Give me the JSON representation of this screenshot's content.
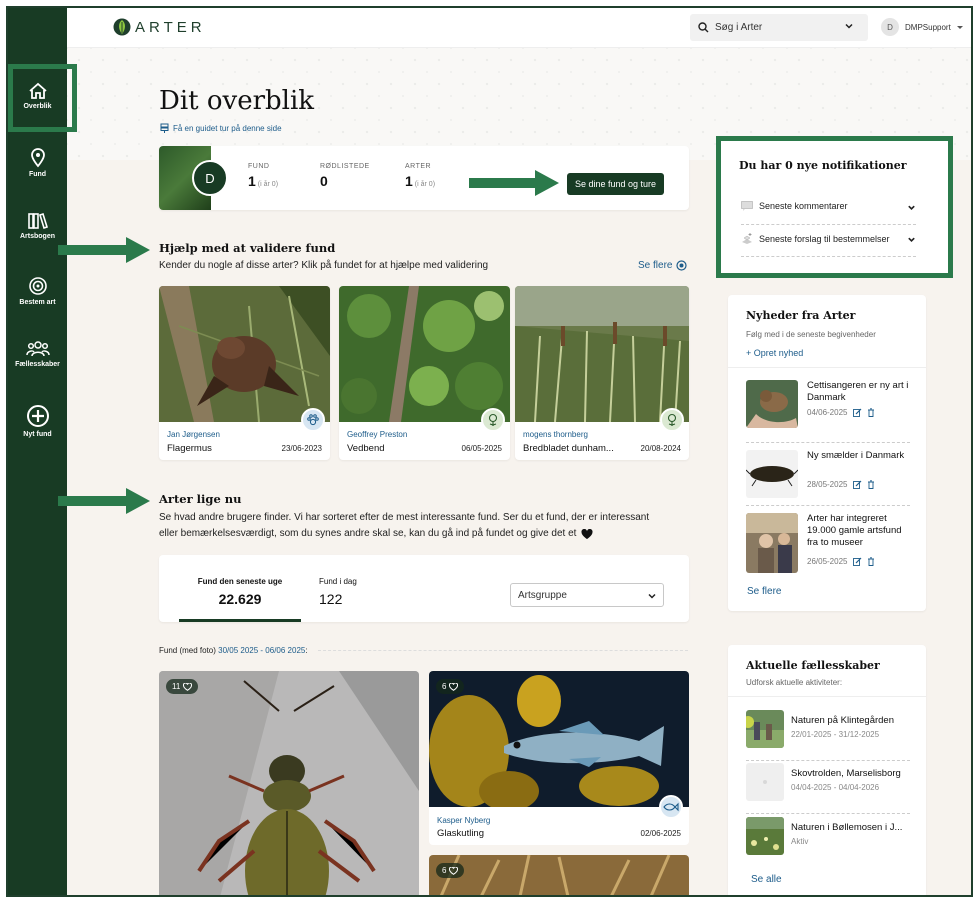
{
  "app": {
    "logo_text": "ARTER"
  },
  "header": {
    "search_placeholder": "Søg i Arter",
    "user_initial": "D",
    "user_name": "DMPSupport"
  },
  "sidebar": {
    "items": [
      {
        "label": "Overblik",
        "icon": "home-icon",
        "active": true
      },
      {
        "label": "Fund",
        "icon": "map-pin-icon"
      },
      {
        "label": "Artsbogen",
        "icon": "books-icon"
      },
      {
        "label": "Bestem art",
        "icon": "target-icon"
      },
      {
        "label": "Fællesskaber",
        "icon": "people-icon"
      },
      {
        "label": "Nyt fund",
        "icon": "plus-circle-icon"
      }
    ]
  },
  "page": {
    "title": "Dit overblik",
    "guide_link": "Få en guidet tur på denne side"
  },
  "stats": {
    "avatar_initial": "D",
    "items": [
      {
        "label": "FUND",
        "value": "1",
        "sub": "(i år 0)"
      },
      {
        "label": "RØDLISTEDE",
        "value": "0",
        "sub": ""
      },
      {
        "label": "ARTER",
        "value": "1",
        "sub": "(i år 0)"
      }
    ],
    "button": "Se dine fund og ture"
  },
  "validate": {
    "title": "Hjælp med at validere fund",
    "description": "Kender du nogle af disse arter? Klik på fundet for at hjælpe med validering",
    "see_more": "Se flere",
    "cards": [
      {
        "user": "Jan Jørgensen",
        "name": "Flagermus",
        "date": "23/06-2023",
        "icon": "paw-icon"
      },
      {
        "user": "Geoffrey Preston",
        "name": "Vedbend",
        "date": "06/05-2025",
        "icon": "plant-icon"
      },
      {
        "user": "mogens thornberg",
        "name": "Bredbladet dunham...",
        "date": "20/08-2024",
        "icon": "plant-icon"
      }
    ]
  },
  "trending": {
    "title": "Arter lige nu",
    "description_line1": "Se hvad andre brugere finder. Vi har sorteret efter de mest interessante fund. Ser du et fund, der er interessant",
    "description_line2": "eller bemærkelsesværdigt, som du synes andre skal se, kan du gå ind på fundet og give det et",
    "tabs": [
      {
        "label": "Fund den seneste uge",
        "value": "22.629",
        "active": true
      },
      {
        "label": "Fund i dag",
        "value": "122"
      }
    ],
    "select_value": "Artsgruppe",
    "range_label": "Fund (med foto)",
    "range_dates": "30/05 2025 - 06/06 2025",
    "range_suffix": ":",
    "cards": [
      {
        "likes": "11"
      },
      {
        "likes": "6",
        "user": "Kasper Nyberg",
        "name": "Glaskutling",
        "date": "02/06-2025",
        "icon": "fish-icon"
      },
      {
        "likes": "6"
      }
    ]
  },
  "notifications": {
    "title": "Du har 0 nye notifikationer",
    "items": [
      {
        "label": "Seneste kommentarer",
        "icon": "comment-icon"
      },
      {
        "label": "Seneste forslag til bestemmelser",
        "icon": "suggestion-icon"
      }
    ]
  },
  "news": {
    "title": "Nyheder fra Arter",
    "subtitle": "Følg med i de seneste begivenheder",
    "create": "+ Opret nyhed",
    "items": [
      {
        "title": "Cettisangeren er ny art i Danmark",
        "date": "04/06-2025"
      },
      {
        "title": "Ny smælder i Danmark",
        "date": "28/05-2025"
      },
      {
        "title": "Arter har integreret 19.000 gamle artsfund fra to museer",
        "date": "26/05-2025"
      }
    ],
    "see_more": "Se flere"
  },
  "communities": {
    "title": "Aktuelle fællesskaber",
    "subtitle": "Udforsk aktuelle aktiviteter:",
    "items": [
      {
        "title": "Naturen på Klintegården",
        "date": "22/01-2025 - 31/12-2025"
      },
      {
        "title": "Skovtrolden, Marselisborg",
        "date": "04/04-2025 - 04/04-2026"
      },
      {
        "title": "Naturen i Bøllemosen i J...",
        "date": "Aktiv"
      }
    ],
    "see_all": "Se alle"
  }
}
